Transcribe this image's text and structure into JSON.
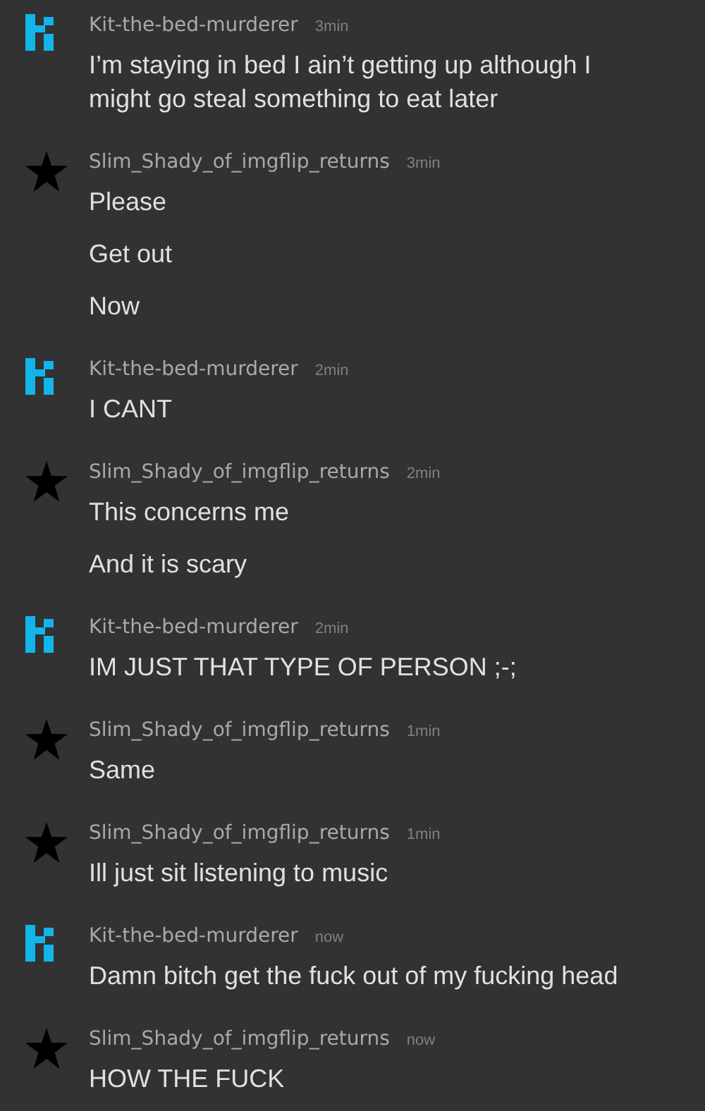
{
  "messages": [
    {
      "kind": "pixel",
      "user": "Kit-the-bed-murderer",
      "time": "3min",
      "lines": [
        "I’m staying in bed I ain’t getting up although I might go steal something to eat later"
      ]
    },
    {
      "kind": "star",
      "user": "Slim_Shady_of_imgflip_returns",
      "time": "3min",
      "lines": [
        "Please",
        "Get out",
        "Now"
      ]
    },
    {
      "kind": "pixel",
      "user": "Kit-the-bed-murderer",
      "time": "2min",
      "lines": [
        "I CANT"
      ]
    },
    {
      "kind": "star",
      "user": "Slim_Shady_of_imgflip_returns",
      "time": "2min",
      "lines": [
        "This concerns me",
        "And it is scary"
      ]
    },
    {
      "kind": "pixel",
      "user": "Kit-the-bed-murderer",
      "time": "2min",
      "lines": [
        "IM JUST THAT TYPE OF PERSON ;-;"
      ]
    },
    {
      "kind": "star",
      "user": "Slim_Shady_of_imgflip_returns",
      "time": "1min",
      "lines": [
        "Same"
      ]
    },
    {
      "kind": "star",
      "user": "Slim_Shady_of_imgflip_returns",
      "time": "1min",
      "lines": [
        "Ill just sit listening to music"
      ]
    },
    {
      "kind": "pixel",
      "user": "Kit-the-bed-murderer",
      "time": "now",
      "lines": [
        "Damn bitch get the fuck out of my fucking head"
      ]
    },
    {
      "kind": "star",
      "user": "Slim_Shady_of_imgflip_returns",
      "time": "now",
      "lines": [
        "HOW THE FUCK"
      ]
    }
  ]
}
